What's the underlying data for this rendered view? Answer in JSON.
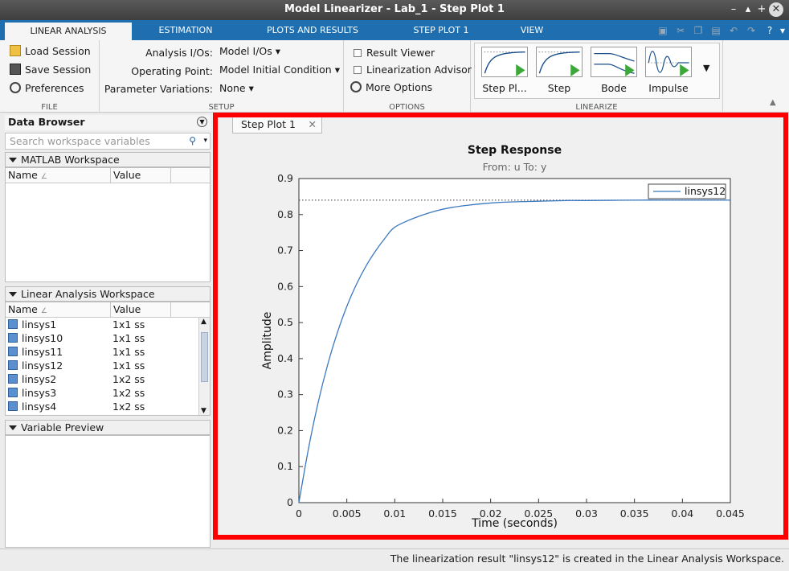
{
  "window": {
    "title": "Model Linearizer - Lab_1 - Step Plot 1",
    "controls": [
      "–",
      "▴",
      "+",
      "✕"
    ]
  },
  "ribbon_tabs": [
    {
      "label": "LINEAR ANALYSIS",
      "active": true
    },
    {
      "label": "ESTIMATION",
      "active": false
    },
    {
      "label": "PLOTS AND RESULTS",
      "active": false
    },
    {
      "label": "STEP PLOT 1",
      "active": false
    },
    {
      "label": "VIEW",
      "active": false
    }
  ],
  "ribbon": {
    "file": {
      "caption": "FILE",
      "load": "Load Session",
      "save": "Save Session",
      "prefs": "Preferences"
    },
    "setup": {
      "caption": "SETUP",
      "ios_label": "Analysis I/Os:",
      "ios_value": "Model I/Os",
      "op_label": "Operating Point:",
      "op_value": "Model Initial Condition",
      "pv_label": "Parameter Variations:",
      "pv_value": "None"
    },
    "options": {
      "caption": "OPTIONS",
      "result_viewer": "Result Viewer",
      "advisor": "Linearization Advisor",
      "more": "More Options"
    },
    "linearize": {
      "caption": "LINEARIZE",
      "gallery": [
        "Step Pl...",
        "Step",
        "Bode",
        "Impulse"
      ]
    }
  },
  "data_browser": {
    "title": "Data Browser",
    "search_placeholder": "Search workspace variables",
    "matlab_ws": {
      "title": "MATLAB Workspace",
      "col_name": "Name",
      "col_value": "Value"
    },
    "linear_ws": {
      "title": "Linear Analysis Workspace",
      "col_name": "Name",
      "col_value": "Value",
      "rows": [
        {
          "name": "linsys1",
          "value": "1x1 ss"
        },
        {
          "name": "linsys10",
          "value": "1x1 ss"
        },
        {
          "name": "linsys11",
          "value": "1x1 ss"
        },
        {
          "name": "linsys12",
          "value": "1x1 ss"
        },
        {
          "name": "linsys2",
          "value": "1x2 ss"
        },
        {
          "name": "linsys3",
          "value": "1x2 ss"
        },
        {
          "name": "linsys4",
          "value": "1x2 ss"
        }
      ]
    },
    "preview": {
      "title": "Variable Preview"
    }
  },
  "plot_tab": {
    "label": "Step Plot 1"
  },
  "chart_data": {
    "type": "line",
    "title": "Step Response",
    "subtitle": "From: u  To: y",
    "xlabel": "Time (seconds)",
    "ylabel": "Amplitude",
    "xlim": [
      0,
      0.045
    ],
    "ylim": [
      0,
      0.9
    ],
    "xticks": [
      "0",
      "0.005",
      "0.01",
      "0.015",
      "0.02",
      "0.025",
      "0.03",
      "0.035",
      "0.04",
      "0.045"
    ],
    "yticks": [
      "0",
      "0.1",
      "0.2",
      "0.3",
      "0.4",
      "0.5",
      "0.6",
      "0.7",
      "0.8",
      "0.9"
    ],
    "legend_position": "top-right",
    "grid": false,
    "series": [
      {
        "name": "linsys12",
        "color": "#3b78c0",
        "x": [
          0,
          0.001,
          0.002,
          0.003,
          0.004,
          0.005,
          0.006,
          0.007,
          0.008,
          0.009,
          0.01,
          0.012,
          0.014,
          0.016,
          0.018,
          0.02,
          0.022,
          0.025,
          0.028,
          0.03,
          0.035,
          0.04,
          0.045
        ],
        "y": [
          0,
          0.15,
          0.277,
          0.383,
          0.471,
          0.545,
          0.606,
          0.657,
          0.699,
          0.735,
          0.765,
          0.79,
          0.808,
          0.82,
          0.827,
          0.832,
          0.835,
          0.837,
          0.839,
          0.839,
          0.84,
          0.84,
          0.84
        ]
      }
    ],
    "steady_state": 0.84
  },
  "status": {
    "message": "The linearization result \"linsys12\" is created in the Linear Analysis Workspace."
  }
}
